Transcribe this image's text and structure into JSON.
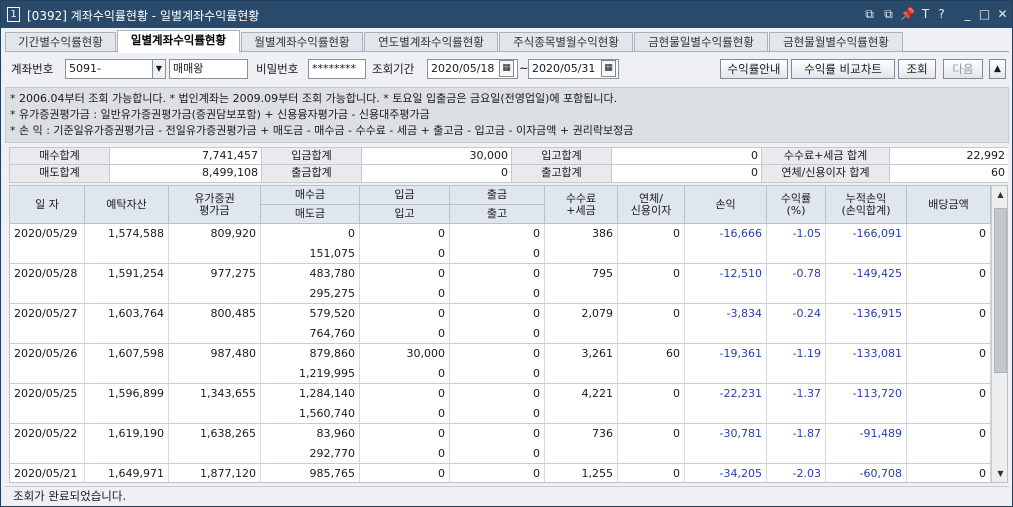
{
  "window": {
    "number": "1",
    "title": "[0392] 계좌수익률현황 - 일별계좌수익률현황",
    "controls": [
      "⧉",
      "⧉",
      "📌",
      "T",
      "?",
      "_",
      "□",
      "✕"
    ]
  },
  "tabs": [
    {
      "label": "기간별수익률현황"
    },
    {
      "label": "일별계좌수익률현황"
    },
    {
      "label": "월별계좌수익률현황"
    },
    {
      "label": "연도별계좌수익률현황"
    },
    {
      "label": "주식종목별월수익현황"
    },
    {
      "label": "금현물일별수익률현황"
    },
    {
      "label": "금현물월별수익률현황"
    }
  ],
  "query": {
    "account_label": "계좌번호",
    "account_value": "5091-",
    "account_name": "매매왕",
    "password_label": "비밀번호",
    "password_value": "********",
    "period_label": "조회기간",
    "date_from": "2020/05/18",
    "date_to": "2020/05/31",
    "tilde": "~",
    "btn_guide": "수익률안내",
    "btn_chart": "수익률 비교차트",
    "btn_query": "조회",
    "btn_next": "다음",
    "btn_up": "▲"
  },
  "notes": [
    "* 2006.04부터 조회 가능합니다.   * 법인계좌는 2009.09부터 조회 가능합니다.   * 토요일 입출금은 금요일(전영업일)에 포함됩니다.",
    "* 유가증권평가금 : 일반유가증권평가금(증권담보포함) + 신용융자평가금 - 신용대주평가금",
    "* 손          익 : 기준일유가증권평가금 - 전일유가증권평가금 + 매도금 - 매수금 - 수수료 - 세금 + 출고금 - 입고금 - 이자금액 + 권리락보정금"
  ],
  "summary": {
    "buy_total_label": "매수합계",
    "buy_total": "7,741,457",
    "deposit_total_label": "입금합계",
    "deposit_total": "30,000",
    "in_total_label": "입고합계",
    "in_total": "0",
    "fee_tax_label": "수수료+세금 합계",
    "fee_tax_total": "22,992",
    "sell_total_label": "매도합계",
    "sell_total": "8,499,108",
    "withdraw_total_label": "출금합계",
    "withdraw_total": "0",
    "out_total_label": "출고합계",
    "out_total": "0",
    "interest_label": "연체/신용이자 합계",
    "interest_total": "60"
  },
  "grid": {
    "headers": {
      "date": "일 자",
      "deposit": "예탁자산",
      "securities": "유가증권\n평가금",
      "buy": "매수금",
      "sell": "매도금",
      "deposit_in": "입금",
      "stock_in": "입고",
      "withdraw": "출금",
      "stock_out": "출고",
      "fee": "수수료\n+세금",
      "overdue": "연체/\n신용이자",
      "pnl": "손익",
      "rate": "수익률\n(%)",
      "cum_pnl": "누적손익\n(손익합계)",
      "dividend": "배당금액"
    },
    "rows": [
      {
        "date": "2020/05/29",
        "deposit": "1,574,588",
        "securities": "809,920",
        "buy": "0",
        "sell": "151,075",
        "deposit_in": "0",
        "stock_in": "0",
        "withdraw": "0",
        "stock_out": "0",
        "fee": "386",
        "overdue": "0",
        "pnl": "-16,666",
        "rate": "-1.05",
        "cum_pnl": "-166,091",
        "dividend": "0"
      },
      {
        "date": "2020/05/28",
        "deposit": "1,591,254",
        "securities": "977,275",
        "buy": "483,780",
        "sell": "295,275",
        "deposit_in": "0",
        "stock_in": "0",
        "withdraw": "0",
        "stock_out": "0",
        "fee": "795",
        "overdue": "0",
        "pnl": "-12,510",
        "rate": "-0.78",
        "cum_pnl": "-149,425",
        "dividend": "0"
      },
      {
        "date": "2020/05/27",
        "deposit": "1,603,764",
        "securities": "800,485",
        "buy": "579,520",
        "sell": "764,760",
        "deposit_in": "0",
        "stock_in": "0",
        "withdraw": "0",
        "stock_out": "0",
        "fee": "2,079",
        "overdue": "0",
        "pnl": "-3,834",
        "rate": "-0.24",
        "cum_pnl": "-136,915",
        "dividend": "0"
      },
      {
        "date": "2020/05/26",
        "deposit": "1,607,598",
        "securities": "987,480",
        "buy": "879,860",
        "sell": "1,219,995",
        "deposit_in": "30,000",
        "stock_in": "0",
        "withdraw": "0",
        "stock_out": "0",
        "fee": "3,261",
        "overdue": "60",
        "pnl": "-19,361",
        "rate": "-1.19",
        "cum_pnl": "-133,081",
        "dividend": "0"
      },
      {
        "date": "2020/05/25",
        "deposit": "1,596,899",
        "securities": "1,343,655",
        "buy": "1,284,140",
        "sell": "1,560,740",
        "deposit_in": "0",
        "stock_in": "0",
        "withdraw": "0",
        "stock_out": "0",
        "fee": "4,221",
        "overdue": "0",
        "pnl": "-22,231",
        "rate": "-1.37",
        "cum_pnl": "-113,720",
        "dividend": "0"
      },
      {
        "date": "2020/05/22",
        "deposit": "1,619,190",
        "securities": "1,638,265",
        "buy": "83,960",
        "sell": "292,770",
        "deposit_in": "0",
        "stock_in": "0",
        "withdraw": "0",
        "stock_out": "0",
        "fee": "736",
        "overdue": "0",
        "pnl": "-30,781",
        "rate": "-1.87",
        "cum_pnl": "-91,489",
        "dividend": "0"
      },
      {
        "date": "2020/05/21",
        "deposit": "1,649,971",
        "securities": "1,877,120",
        "buy": "985,765",
        "sell": "",
        "deposit_in": "0",
        "stock_in": "",
        "withdraw": "0",
        "stock_out": "",
        "fee": "1,255",
        "overdue": "0",
        "pnl": "-34,205",
        "rate": "-2.03",
        "cum_pnl": "-60,708",
        "dividend": "0"
      }
    ]
  },
  "status": "조회가 완료되었습니다.",
  "colors": {
    "titlebar": "#2a4a6b",
    "negative": "#2740a5",
    "header": "#dfe6ef"
  }
}
